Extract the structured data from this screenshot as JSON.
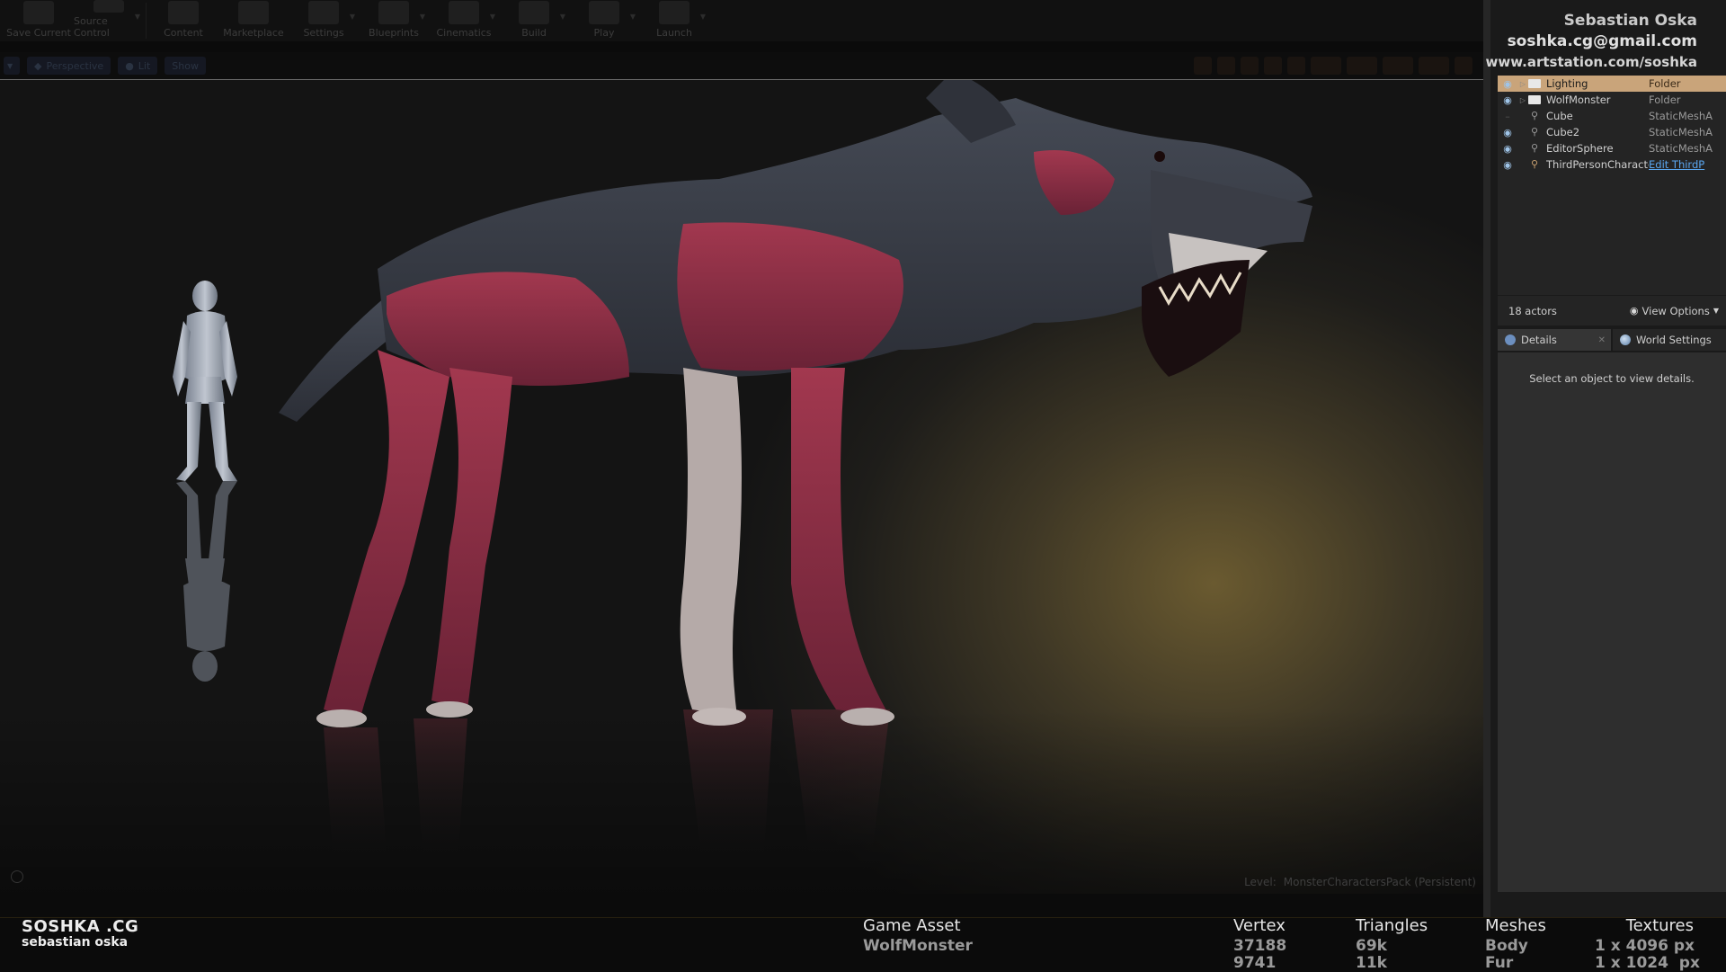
{
  "toolbar": {
    "buttons": [
      {
        "label": "Save Current",
        "icon": "save-icon"
      },
      {
        "label": "Source Control",
        "icon": "source-control-icon"
      },
      {
        "label": "Content",
        "icon": "content-icon"
      },
      {
        "label": "Marketplace",
        "icon": "marketplace-icon"
      },
      {
        "label": "Settings",
        "icon": "gear-icon"
      },
      {
        "label": "Blueprints",
        "icon": "blueprint-icon"
      },
      {
        "label": "Cinematics",
        "icon": "cinematics-icon"
      },
      {
        "label": "Build",
        "icon": "build-icon"
      },
      {
        "label": "Play",
        "icon": "play-icon"
      },
      {
        "label": "Launch",
        "icon": "launch-icon"
      }
    ]
  },
  "viewport_bar": {
    "perspective": "Perspective",
    "lit": "Lit",
    "show": "Show"
  },
  "credit": {
    "name": "Sebastian Oska",
    "email": "soshka.cg@gmail.com",
    "site": "www.artstation.com/soshka"
  },
  "outliner": {
    "rows": [
      {
        "name": "Lighting",
        "type": "Folder",
        "selected": true,
        "icon": "folder-icon"
      },
      {
        "name": "WolfMonster",
        "type": "Folder",
        "selected": false,
        "icon": "folder-icon"
      },
      {
        "name": "Cube",
        "type": "StaticMeshA",
        "selected": false,
        "icon": "static-mesh-icon"
      },
      {
        "name": "Cube2",
        "type": "StaticMeshA",
        "selected": false,
        "icon": "static-mesh-icon"
      },
      {
        "name": "EditorSphere",
        "type": "StaticMeshA",
        "selected": false,
        "icon": "static-mesh-icon"
      },
      {
        "name": "ThirdPersonCharacte",
        "type": "Edit ThirdP",
        "selected": false,
        "icon": "character-icon"
      }
    ],
    "actor_count": "18 actors",
    "view_options": "View Options"
  },
  "details": {
    "tab_details": "Details",
    "tab_world": "World Settings",
    "empty_message": "Select an object to view details."
  },
  "level": {
    "label": "Level:",
    "name": "MonsterCharactersPack (Persistent)"
  },
  "info": {
    "brand_top": "SOSHKA .CG",
    "brand_bottom": "sebastian oska",
    "asset_header": "Game Asset",
    "asset_name": "WolfMonster",
    "vertex_header": "Vertex",
    "vertex_1": "37188",
    "vertex_2": "9741",
    "tri_header": "Triangles",
    "tri_1": "69k",
    "tri_2": "11k",
    "mesh_header": "Meshes",
    "mesh_1": "Body",
    "mesh_2": "Fur",
    "tex_header": "Textures",
    "tex_1": "1 x 4096 px",
    "tex_2": "1 x 1024  px"
  },
  "colors": {
    "selection": "#c9a47a",
    "link": "#5aa6ef",
    "panel": "#242424"
  }
}
